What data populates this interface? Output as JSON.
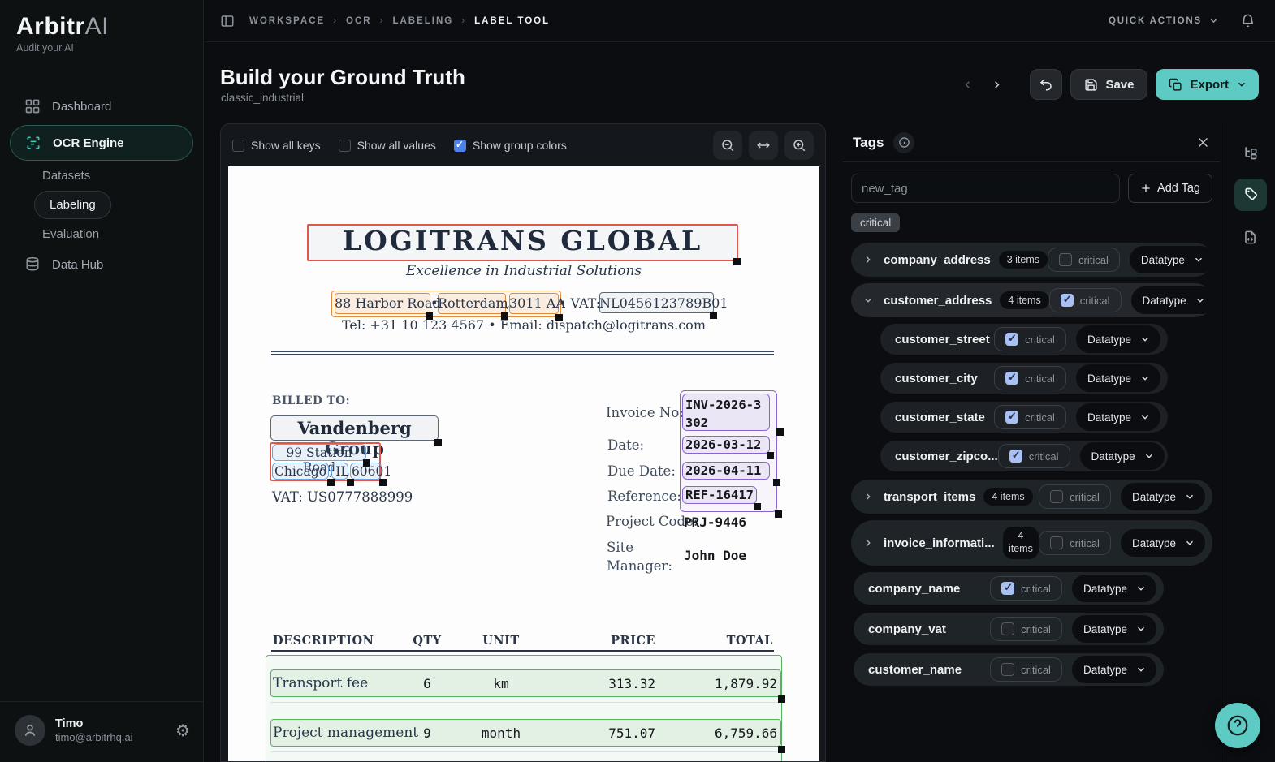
{
  "sidebar": {
    "logo_bold": "Arbitr",
    "logo_thin": "AI",
    "tagline": "Audit your AI",
    "items": {
      "dashboard": "Dashboard",
      "ocr_engine": "OCR Engine",
      "datasets": "Datasets",
      "labeling": "Labeling",
      "evaluation": "Evaluation",
      "data_hub": "Data Hub"
    },
    "user": {
      "name": "Timo",
      "email": "timo@arbitrhq.ai"
    }
  },
  "topbar": {
    "breadcrumb": [
      "WORKSPACE",
      "OCR",
      "LABELING",
      "LABEL TOOL"
    ],
    "quick_actions": "QUICK ACTIONS"
  },
  "header": {
    "title": "Build your Ground Truth",
    "subtitle": "classic_industrial",
    "save_label": "Save",
    "export_label": "Export"
  },
  "canvas_toolbar": {
    "toggles": [
      {
        "label": "Show all keys",
        "checked": false
      },
      {
        "label": "Show all values",
        "checked": false
      },
      {
        "label": "Show group colors",
        "checked": true
      }
    ]
  },
  "document": {
    "company_name": "LOGITRANS GLOBAL",
    "tagline": "Excellence in Industrial Solutions",
    "address": {
      "street": "88 Harbor Road",
      "bullet": "•",
      "city": "Rotterdam",
      "comma": ",",
      "zip": "3011 AA",
      "vat_label": "• VAT:",
      "vat": "NL0456123789B01"
    },
    "contact": "Tel: +31 10 123 4567 • Email: dispatch@logitrans.com",
    "billed_to": "BILLED TO:",
    "customer": {
      "name": "Vandenberg Group",
      "street": "99 Station Road",
      "city": "Chicago",
      "comma": ",",
      "state": "IL",
      "zip": "60601",
      "vat": "VAT: US0777888999"
    },
    "meta": {
      "invoice_no_label": "Invoice No:",
      "invoice_no": "INV-2026-3302",
      "date_label": "Date:",
      "date": "2026-03-12",
      "due_date_label": "Due Date:",
      "due_date": "2026-04-11",
      "reference_label": "Reference:",
      "reference": "REF-16417",
      "project_code_label": "Project Code:",
      "project_code": "PRJ-9446",
      "site_label_1": "Site",
      "site_label_2": "Manager:",
      "site_manager": "John Doe"
    },
    "table": {
      "headers": [
        "DESCRIPTION",
        "QTY",
        "UNIT",
        "PRICE",
        "TOTAL"
      ],
      "rows": [
        [
          "Transport fee",
          "6",
          "km",
          "313.32",
          "1,879.92"
        ],
        [
          "Project management",
          "9",
          "month",
          "751.07",
          "6,759.66"
        ]
      ]
    }
  },
  "tags": {
    "title": "Tags",
    "input_placeholder": "new_tag",
    "add_button": "Add Tag",
    "chip": "critical",
    "critical_label": "critical",
    "datatype_label": "Datatype",
    "rows": [
      {
        "name": "company_address",
        "items": "3 items",
        "critical": false,
        "kind": "group",
        "expanded": false
      },
      {
        "name": "customer_address",
        "items": "4 items",
        "critical": true,
        "kind": "group",
        "expanded": true
      },
      {
        "name": "customer_street",
        "critical": true,
        "kind": "child"
      },
      {
        "name": "customer_city",
        "critical": true,
        "kind": "child"
      },
      {
        "name": "customer_state",
        "critical": true,
        "kind": "child"
      },
      {
        "name": "customer_zipco...",
        "critical": true,
        "kind": "child"
      },
      {
        "name": "transport_items",
        "items": "4 items",
        "critical": false,
        "kind": "group",
        "expanded": false
      },
      {
        "name": "invoice_informati...",
        "items": "4 items",
        "critical": false,
        "kind": "group",
        "expanded": false
      },
      {
        "name": "company_name",
        "critical": true,
        "kind": "single"
      },
      {
        "name": "company_vat",
        "critical": false,
        "kind": "single"
      },
      {
        "name": "customer_name",
        "critical": false,
        "kind": "single"
      }
    ]
  },
  "colors": {
    "accent_teal": "#5ecac4",
    "checkbox_checked_blue": "#a9c0f5",
    "toolbar_checkbox_blue": "#4d82e8",
    "box_red": "#e2574b",
    "box_orange": "#e08c3c",
    "box_blue": "#6aa3e0",
    "box_purple": "#8a63d2",
    "box_green": "#56b25c",
    "nav_active_border": "#2b5c56"
  }
}
